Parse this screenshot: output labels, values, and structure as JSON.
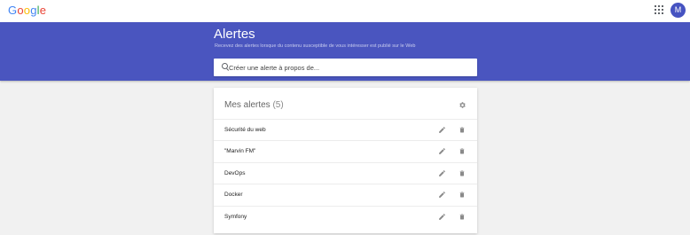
{
  "header": {
    "logo_letters": [
      {
        "ch": "G",
        "color": "#4285f4"
      },
      {
        "ch": "o",
        "color": "#ea4335"
      },
      {
        "ch": "o",
        "color": "#fbbc05"
      },
      {
        "ch": "g",
        "color": "#4285f4"
      },
      {
        "ch": "l",
        "color": "#34a853"
      },
      {
        "ch": "e",
        "color": "#ea4335"
      }
    ],
    "avatar_initial": "M",
    "apps_icon": "apps-grid-icon"
  },
  "hero": {
    "title": "Alertes",
    "subtitle": "Recevez des alertes lorsque du contenu susceptible de vous intéresser est publié sur le Web",
    "background": "#4a55bf"
  },
  "search": {
    "placeholder": "Créer une alerte à propos de...",
    "value": "",
    "icon": "search-icon"
  },
  "alerts_card": {
    "title": "Mes alertes",
    "count": "(5)",
    "settings_icon": "gear-icon",
    "items": [
      {
        "label": "Sécurité du web"
      },
      {
        "label": "\"Marvin FM\""
      },
      {
        "label": "DevOps"
      },
      {
        "label": "Docker"
      },
      {
        "label": "Symfony"
      }
    ]
  },
  "colors": {
    "brand_blue": "#4a55bf",
    "page_bg": "#f1f1f1",
    "icon_gray": "#8a8a8a"
  }
}
